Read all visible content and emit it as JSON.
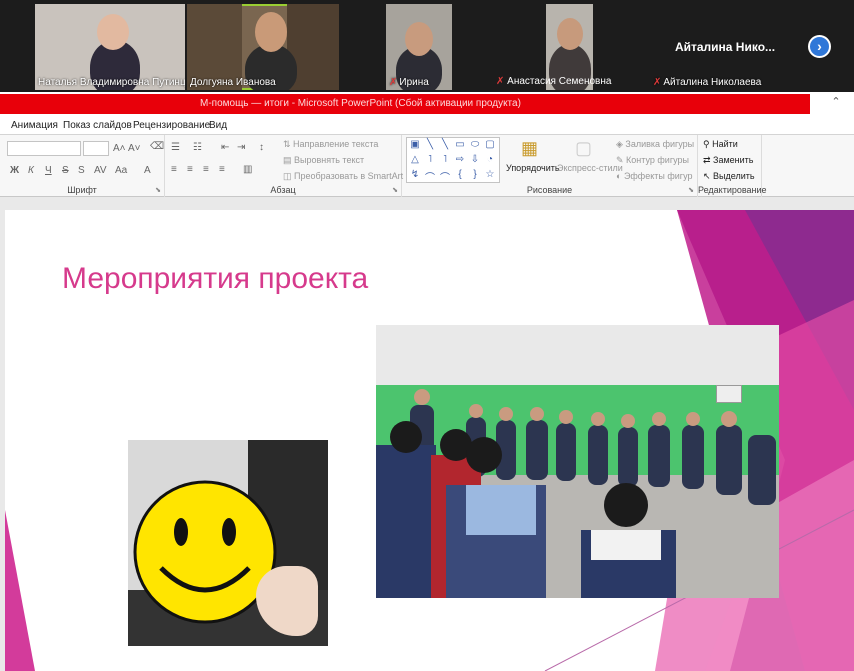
{
  "conference": {
    "participants": [
      {
        "name": "Наталья Владимировна Путинц...",
        "muted": false,
        "active": false
      },
      {
        "name": "Долгуяна Иванова",
        "muted": false,
        "active": true
      },
      {
        "name": "Ирина",
        "muted": true,
        "active": false
      },
      {
        "name": "Анастасия Семеновна",
        "muted": true,
        "active": false
      },
      {
        "name": "Айталина Николаева",
        "muted": true,
        "active": false
      }
    ],
    "solo_name": "Айталина Нико...",
    "next_icon": "chevron-right-icon"
  },
  "window": {
    "title": "М-помощь — итоги - Microsoft PowerPoint (Сбой активации продукта)"
  },
  "ribbon": {
    "tabs": [
      "Анимация",
      "Показ слайдов",
      "Рецензирование",
      "Вид"
    ],
    "groups": {
      "font": "Шрифт",
      "paragraph": "Абзац",
      "drawing": "Рисование",
      "editing": "Редактирование"
    },
    "paragraph_controls": {
      "text_direction": "Направление текста",
      "align_text": "Выровнять текст",
      "smartart": "Преобразовать в SmartArt"
    },
    "drawing_controls": {
      "arrange": "Упорядочить",
      "quick_styles": "Экспресс-стили",
      "shape_fill": "Заливка фигуры",
      "shape_outline": "Контур фигуры",
      "shape_effects": "Эффекты фигур"
    },
    "editing_controls": {
      "find": "Найти",
      "replace": "Заменить",
      "select": "Выделить"
    }
  },
  "slide": {
    "title": "Мероприятия проекта"
  },
  "colors": {
    "accent_pink": "#d63a8c",
    "titlebar_red": "#e8000a"
  }
}
